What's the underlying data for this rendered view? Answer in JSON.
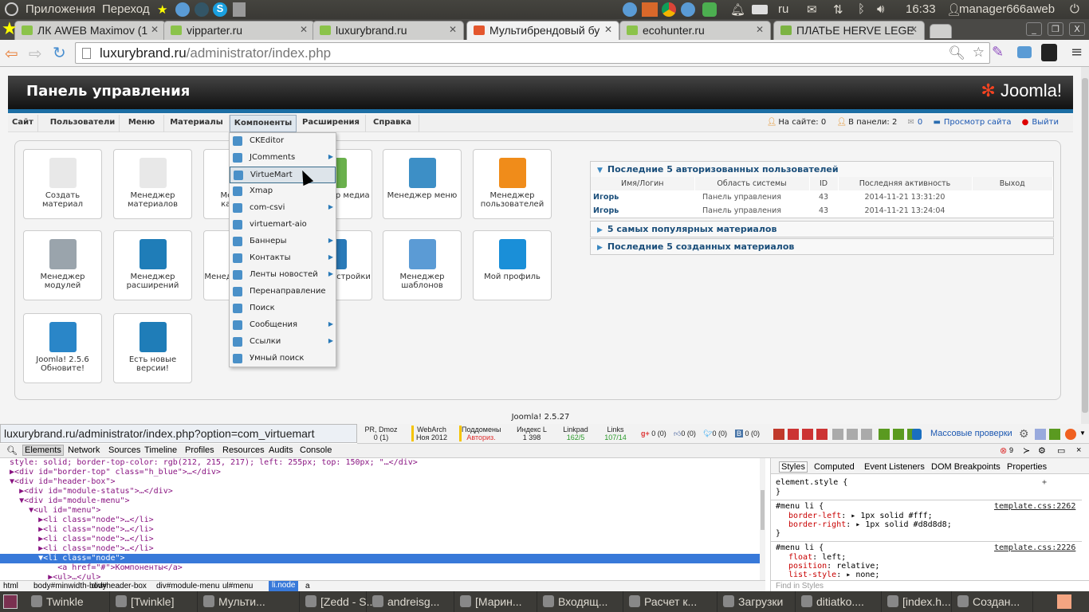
{
  "topbar": {
    "apps": "Приложения",
    "places": "Переход",
    "lang": "ru",
    "time": "16:33",
    "user": "manager666aweb"
  },
  "tabs": [
    {
      "label": "ЛК AWEB Maximov (1"
    },
    {
      "label": "vipparter.ru"
    },
    {
      "label": "luxurybrand.ru"
    },
    {
      "label": "Мультибрендовый бу"
    },
    {
      "label": "ecohunter.ru"
    },
    {
      "label": "ПЛАТЬЕ HERVE LEGE"
    }
  ],
  "omnibox": {
    "host": "luxurybrand.ru",
    "path": "/administrator/index.php"
  },
  "joomla": {
    "title": "Панель управления",
    "logo": "Joomla!",
    "menu": [
      "Сайт",
      "Пользователи",
      "Меню",
      "Материалы",
      "Компоненты",
      "Расширения",
      "Справка"
    ],
    "status": {
      "on_site": "На сайте: 0",
      "in_panel": "В панели: 2",
      "messages": "0",
      "view_site": "Просмотр сайта",
      "logout": "Выйти"
    },
    "tiles": [
      {
        "label": "Создать материал",
        "color": "#e8e8e8"
      },
      {
        "label": "Менеджер материалов",
        "color": "#e8e8e8"
      },
      {
        "label": "Менеджер категорий",
        "color": "#f0a020"
      },
      {
        "label": "Менеджер медиа",
        "color": "#6ab04c"
      },
      {
        "label": "Менеджер меню",
        "color": "#3d8fc6"
      },
      {
        "label": "Менеджер пользователей",
        "color": "#f08c1a"
      },
      {
        "label": "Менеджер модулей",
        "color": "#9aa4ac"
      },
      {
        "label": "Менеджер расширений",
        "color": "#1f7db8"
      },
      {
        "label": "Менеджер языков",
        "color": "#1f7db8"
      },
      {
        "label": "Общие настройки",
        "color": "#2a7ab8"
      },
      {
        "label": "Менеджер шаблонов",
        "color": "#5b9bd5"
      },
      {
        "label": "Мой профиль",
        "color": "#1a8fd8"
      },
      {
        "label": "Joomla! 2.5.6 Обновите!",
        "color": "#2a86c8"
      },
      {
        "label": "Есть новые версии!",
        "color": "#1f7db8"
      }
    ],
    "components_menu": [
      {
        "label": "CKEditor",
        "sub": false
      },
      {
        "label": "JComments",
        "sub": true
      },
      {
        "label": "VirtueMart",
        "sub": false
      },
      {
        "label": "Xmap",
        "sub": false
      },
      {
        "label": "com-csvi",
        "sub": true
      },
      {
        "label": "virtuemart-aio",
        "sub": false
      },
      {
        "label": "Баннеры",
        "sub": true
      },
      {
        "label": "Контакты",
        "sub": true
      },
      {
        "label": "Ленты новостей",
        "sub": true
      },
      {
        "label": "Перенаправление",
        "sub": false
      },
      {
        "label": "Поиск",
        "sub": false
      },
      {
        "label": "Сообщения",
        "sub": true
      },
      {
        "label": "Ссылки",
        "sub": true
      },
      {
        "label": "Умный поиск",
        "sub": false
      }
    ],
    "users_panel": {
      "title": "Последние 5 авторизованных пользователей",
      "columns": [
        "Имя/Логин",
        "Область системы",
        "ID",
        "Последняя активность",
        "Выход"
      ],
      "rows": [
        [
          "Игорь",
          "Панель управления",
          "43",
          "2014-11-21 13:31:20",
          ""
        ],
        [
          "Игорь",
          "Панель управления",
          "43",
          "2014-11-21 13:24:04",
          ""
        ]
      ]
    },
    "popular_panel": "5 самых популярных материалов",
    "latest_panel": "Последние 5 созданных материалов",
    "version": "Joomla! 2.5.27"
  },
  "status_url": "luxurybrand.ru/administrator/index.php?option=com_virtuemart",
  "seo": {
    "pr": [
      "PR, Dmoz",
      "0 (1)"
    ],
    "webarch": [
      "WebArch",
      "Ноя 2012"
    ],
    "subdomains": [
      "Поддомены",
      "Авториз."
    ],
    "index": [
      "Индекс L",
      "1 398"
    ],
    "linkpad": [
      "Linkpad",
      "162/5"
    ],
    "links": [
      "Links",
      "107/14"
    ],
    "gplus": "0 (0)",
    "fb": "0 (0)",
    "tw": "0 (0)",
    "vk": "0 (0)",
    "mass_check": "Массовые проверки"
  },
  "devtools": {
    "tabs": [
      "Elements",
      "Network",
      "Sources",
      "Timeline",
      "Profiles",
      "Resources",
      "Audits",
      "Console"
    ],
    "errors": "9",
    "lines": [
      "  style: solid; border-top-color: rgb(212, 215, 217); left: 255px; top: 150px; \"…</div>",
      "  ▶<div id=\"border-top\" class=\"h_blue\">…</div>",
      "  ▼<div id=\"header-box\">",
      "    ▶<div id=\"module-status\">…</div>",
      "    ▼<div id=\"module-menu\">",
      "      ▼<ul id=\"menu\">",
      "        ▶<li class=\"node\">…</li>",
      "        ▶<li class=\"node\">…</li>",
      "        ▶<li class=\"node\">…</li>",
      "        ▶<li class=\"node\">…</li>",
      "        ▼<li class=\"node\">",
      "            <a href=\"#\">Компоненты</a>",
      "          ▶<ul>…</ul>"
    ],
    "breadcrumbs": [
      "html",
      "body#minwidth-body",
      "div#header-box",
      "div#module-menu",
      "ul#menu",
      "li.node",
      "a"
    ],
    "style_tabs": [
      "Styles",
      "Computed",
      "Event Listeners",
      "DOM Breakpoints",
      "Properties"
    ],
    "element_style": "element.style {",
    "rule1": {
      "selector": "#menu li {",
      "source": "template.css:2262",
      "props": [
        [
          "border-left",
          "1px solid #fff;"
        ],
        [
          "border-right",
          "1px solid #d8d8d8;"
        ]
      ]
    },
    "rule2": {
      "selector": "#menu li {",
      "source": "template.css:2226",
      "props": [
        [
          "float",
          "left;"
        ],
        [
          "position",
          "relative;"
        ],
        [
          "list-style",
          "none;"
        ]
      ]
    },
    "find_placeholder": "Find in Styles"
  },
  "taskbar": [
    "Twinkle",
    "[Twinkle]",
    "Мульти...",
    "[Zedd - S...",
    "andreisg...",
    "[Марин...",
    "Входящ...",
    "Расчет к...",
    "Загрузки",
    "ditiatko....",
    "[index.h...",
    "Создан..."
  ]
}
